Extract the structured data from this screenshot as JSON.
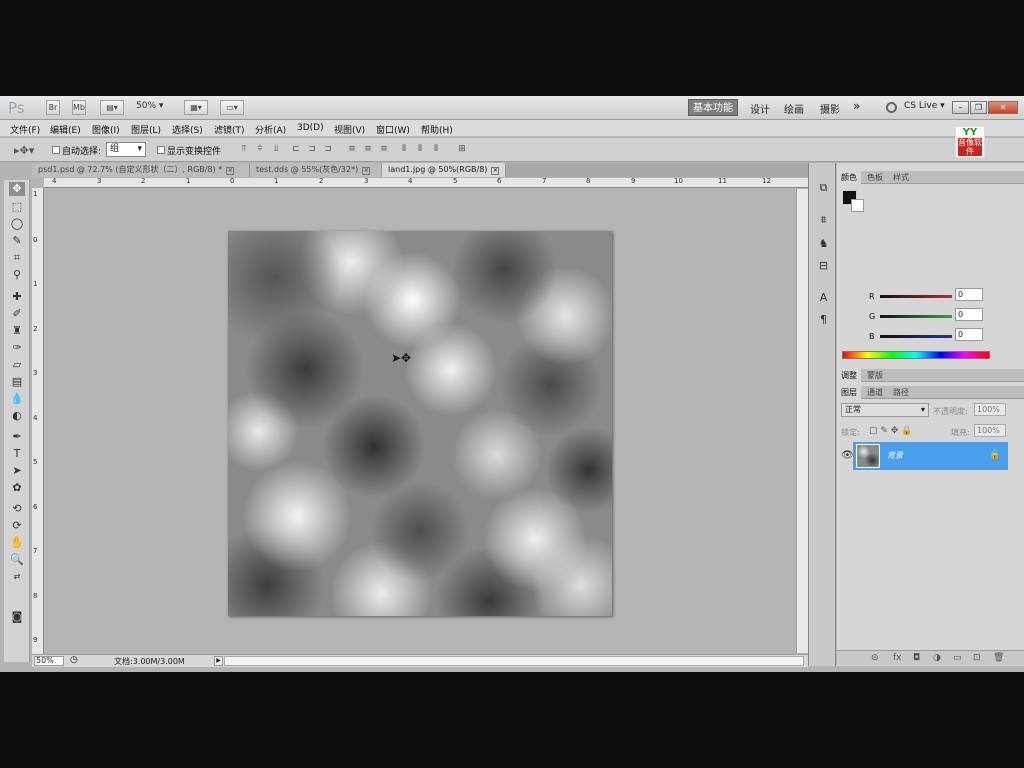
{
  "app": {
    "logo": "Ps",
    "bridge_label": "Br",
    "mini_bridge_label": "Mb",
    "zoom_select": "50%",
    "workspaces": {
      "active": "基本功能",
      "items": [
        "设计",
        "绘画",
        "摄影"
      ],
      "more": "»"
    },
    "cs_live": "CS Live ▾"
  },
  "menu": {
    "items": [
      "文件(F)",
      "编辑(E)",
      "图像(I)",
      "图层(L)",
      "选择(S)",
      "滤镜(T)",
      "分析(A)",
      "3D(D)",
      "视图(V)",
      "窗口(W)",
      "帮助(H)"
    ]
  },
  "badge": {
    "top": "YY",
    "bottom": "音像软件"
  },
  "options": {
    "auto_select_label": "自动选择:",
    "auto_select_value": "组",
    "show_transform_label": "显示变换控件"
  },
  "tabs": [
    {
      "label": "psd1.psd @ 72.7% (自定义形状（二）, RGB/8) *",
      "active": false
    },
    {
      "label": "test.dds @ 55%(灰色/32*)",
      "active": false
    },
    {
      "label": "land1.jpg @ 50%(RGB/8)",
      "active": true
    }
  ],
  "ruler": {
    "top_ticks": [
      "4",
      "3",
      "2",
      "1",
      "0",
      "1",
      "2",
      "3",
      "4",
      "5",
      "6",
      "7",
      "8",
      "9",
      "10",
      "11",
      "12"
    ],
    "left_ticks": [
      "1",
      "0",
      "1",
      "2",
      "3",
      "4",
      "5",
      "6",
      "7",
      "8",
      "9"
    ]
  },
  "status": {
    "zoom": "50%",
    "doc_info": "文档:3.00M/3.00M"
  },
  "color_panel": {
    "tabs": [
      "颜色",
      "色板",
      "样式"
    ],
    "channels": [
      {
        "label": "R",
        "value": "0",
        "color": "#d42020"
      },
      {
        "label": "G",
        "value": "0",
        "color": "#20b030"
      },
      {
        "label": "B",
        "value": "0",
        "color": "#2030c0"
      }
    ]
  },
  "adjust_panel": {
    "tabs": [
      "调整",
      "蒙版"
    ]
  },
  "layers_panel": {
    "tabs": [
      "图层",
      "通道",
      "路径"
    ],
    "blend_mode": "正常",
    "opacity_label": "不透明度:",
    "opacity_value": "100%",
    "lock_label": "锁定:",
    "fill_label": "填充:",
    "fill_value": "100%",
    "layers": [
      {
        "name": "背景",
        "selected": true
      }
    ]
  },
  "colors": {
    "selected_layer": "#4a9fea",
    "workspace_active": "#7e7e7e"
  }
}
